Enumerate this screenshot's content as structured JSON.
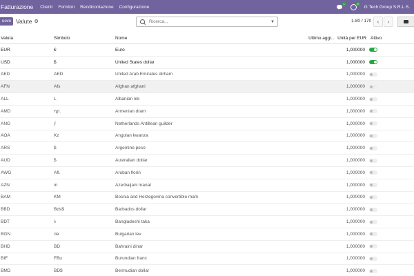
{
  "navbar": {
    "app_name": "Fatturazione",
    "menu": [
      "Clienti",
      "Fornitori",
      "Rendicontazione",
      "Configurazione"
    ],
    "chat_badge": "1",
    "activity_badge": "5",
    "company": "G Tech Group S.R.L.S."
  },
  "control": {
    "new_button": "uovo",
    "breadcrumb": "Valute",
    "search_placeholder": "Ricerca...",
    "pager": "1-80 / 170"
  },
  "table": {
    "headers": {
      "currency": "Valuta",
      "symbol": "Simbolo",
      "name": "Nome",
      "last_update": "Ultimo aggi...",
      "rate": "Unità per EUR",
      "active": "Attivo"
    },
    "rows": [
      {
        "currency": "EUR",
        "symbol": "€",
        "name": "Euro",
        "rate": "1,000000",
        "active": true
      },
      {
        "currency": "USD",
        "symbol": "$",
        "name": "United States dollar",
        "rate": "1,000000",
        "active": true
      },
      {
        "currency": "AED",
        "symbol": "AED",
        "name": "United Arab Emirates dirham",
        "rate": "1,000000",
        "active": false
      },
      {
        "currency": "AFN",
        "symbol": "Afs",
        "name": "Afghan afghani",
        "rate": "1,000000",
        "active": false
      },
      {
        "currency": "ALL",
        "symbol": "L",
        "name": "Albanian lek",
        "rate": "1,000000",
        "active": false
      },
      {
        "currency": "AMD",
        "symbol": "դր.",
        "name": "Armenian dram",
        "rate": "1,000000",
        "active": false
      },
      {
        "currency": "ANG",
        "symbol": "ƒ",
        "name": "Netherlands Antillean guilder",
        "rate": "1,000000",
        "active": false
      },
      {
        "currency": "AOA",
        "symbol": "Kz",
        "name": "Angolan kwanza",
        "rate": "1,000000",
        "active": false
      },
      {
        "currency": "ARS",
        "symbol": "$",
        "name": "Argentine peso",
        "rate": "1,000000",
        "active": false
      },
      {
        "currency": "AUD",
        "symbol": "$",
        "name": "Australian dollar",
        "rate": "1,000000",
        "active": false
      },
      {
        "currency": "AWG",
        "symbol": "Afl.",
        "name": "Aruban florin",
        "rate": "1,000000",
        "active": false
      },
      {
        "currency": "AZN",
        "symbol": "m",
        "name": "Azerbaijani manat",
        "rate": "1,000000",
        "active": false
      },
      {
        "currency": "BAM",
        "symbol": "KM",
        "name": "Bosnia and Herzegovina convertible mark",
        "rate": "1,000000",
        "active": false
      },
      {
        "currency": "BBD",
        "symbol": "Bds$",
        "name": "Barbados dollar",
        "rate": "1,000000",
        "active": false
      },
      {
        "currency": "BDT",
        "symbol": "৳",
        "name": "Bangladeshi taka",
        "rate": "1,000000",
        "active": false
      },
      {
        "currency": "BGN",
        "symbol": "лв",
        "name": "Bulgarian lev",
        "rate": "1,000000",
        "active": false
      },
      {
        "currency": "BHD",
        "symbol": "BD",
        "name": "Bahraini dinar",
        "rate": "1,000000",
        "active": false
      },
      {
        "currency": "BIF",
        "symbol": "FBu",
        "name": "Burundian franc",
        "rate": "1,000000",
        "active": false
      },
      {
        "currency": "BMD",
        "symbol": "BD$",
        "name": "Bermudian dollar",
        "rate": "1,000000",
        "active": false
      }
    ]
  },
  "colors": {
    "brand": "#71639e",
    "toggle_on": "#28a745"
  }
}
